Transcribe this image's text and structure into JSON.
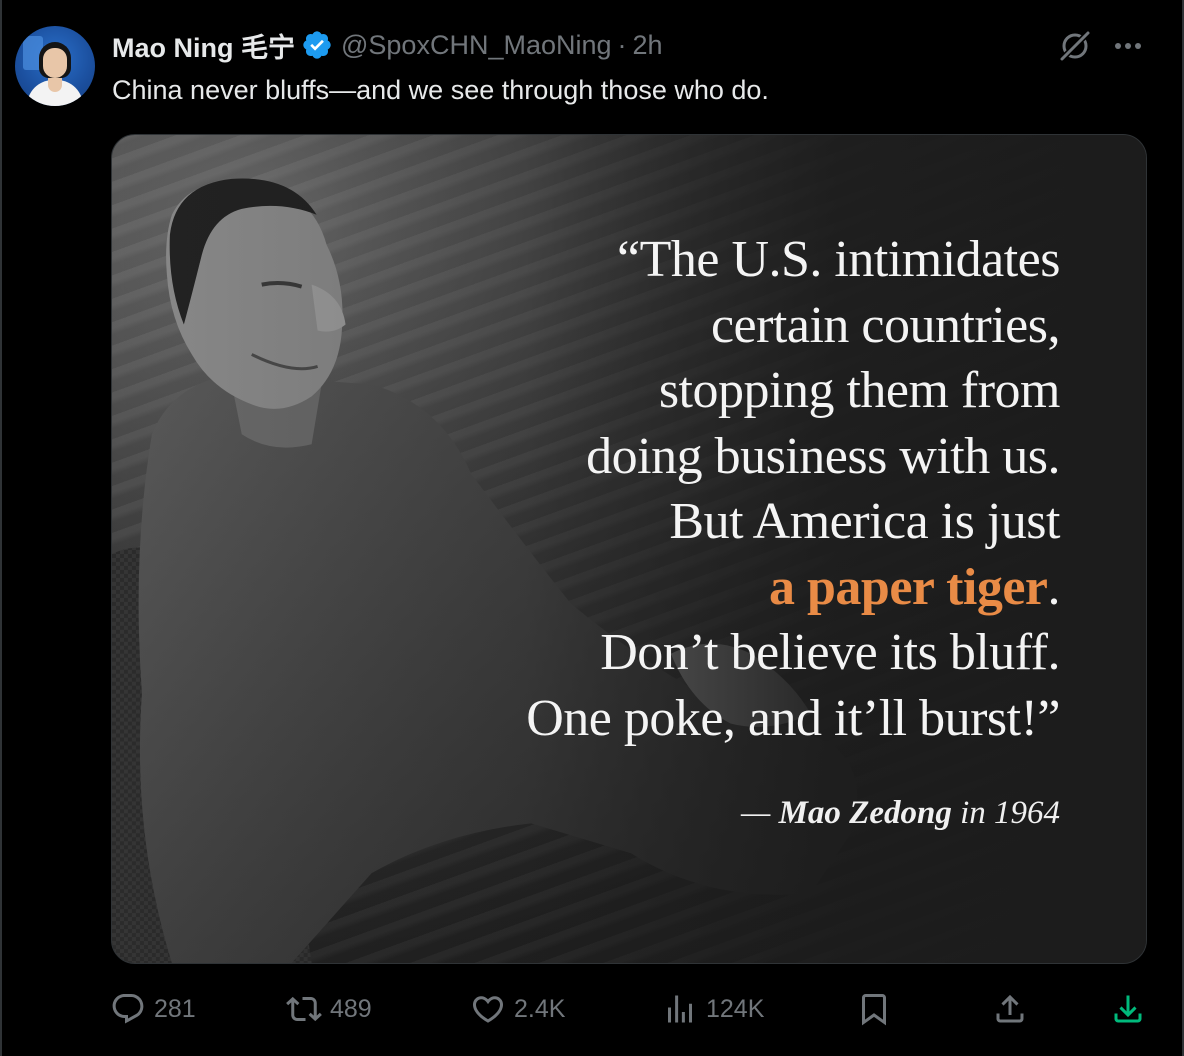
{
  "author": {
    "display_name": "Mao Ning 毛宁",
    "handle": "@SpoxCHN_MaoNing",
    "separator": "·",
    "time": "2h"
  },
  "tweet": {
    "text": "China never bluffs—and we see through those who do."
  },
  "media": {
    "quote_lines": [
      "“The U.S. intimidates",
      "certain countries,",
      "stopping them from",
      "doing business with us.",
      "But America is just"
    ],
    "accent_phrase": "a paper tiger",
    "accent_suffix": ".",
    "quote_lines_after": [
      "Don’t believe its bluff.",
      "One poke, and it’ll burst!”"
    ],
    "attribution_dash": "—",
    "attribution_name": "Mao Zedong",
    "attribution_suffix": "in 1964",
    "accent_color": "#e98b46"
  },
  "actions": {
    "replies": "281",
    "reposts": "489",
    "likes": "2.4K",
    "views": "124K"
  },
  "icons": {
    "verified": "verified-badge-icon",
    "grok": "grok-icon",
    "more": "more-icon",
    "reply": "reply-icon",
    "repost": "repost-icon",
    "like": "heart-icon",
    "views": "views-icon",
    "bookmark": "bookmark-icon",
    "share": "share-icon",
    "download": "download-icon"
  },
  "colors": {
    "background": "#000000",
    "muted": "#71767b",
    "verified": "#1d9bf0",
    "download": "#00ba7c"
  }
}
